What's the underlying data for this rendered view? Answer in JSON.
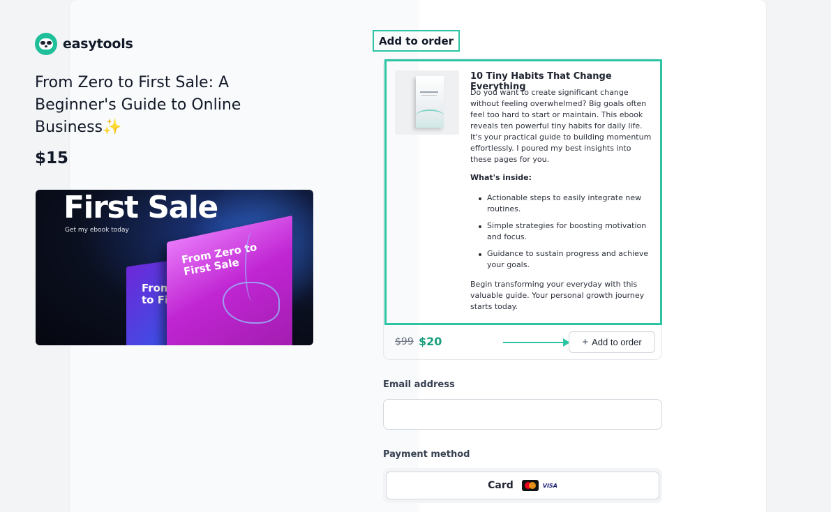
{
  "brand": {
    "name": "easytools"
  },
  "product": {
    "title": "From Zero to First Sale: A Beginner's Guide to Online Business",
    "emoji": "✨",
    "price": "$15",
    "cover": {
      "headline": "First Sale",
      "subline": "Get my ebook today",
      "book_front": "From Zero to First Sale",
      "book_back": "From Zero to First"
    }
  },
  "order_bump": {
    "label": "Add to order",
    "title": "10 Tiny Habits That Change Everything",
    "description": "Do you want to create significant change without feeling overwhelmed? Big goals often feel too hard to start or maintain. This ebook reveals ten powerful tiny habits for daily life. It's your practical guide to building momentum effortlessly. I poured my best insights into these pages for you.",
    "inside_heading": "What's inside:",
    "inside_items": [
      "Actionable steps to easily integrate new routines.",
      "Simple strategies for boosting motivation and focus.",
      "Guidance to sustain progress and achieve your goals."
    ],
    "closing": "Begin transforming your everyday with this valuable guide. Your personal growth journey starts today.",
    "old_price": "$99",
    "new_price": "$20",
    "button_label": "Add to order",
    "accent_color": "#2cc4a3"
  },
  "form": {
    "email_label": "Email address",
    "email_value": "",
    "email_placeholder": "",
    "payment_label": "Payment method",
    "payment_option": "Card",
    "visa_text": "VISA"
  },
  "icons": [
    "sloth-logo-icon",
    "plus-icon",
    "arrow-right-icon",
    "mastercard-icon",
    "visa-icon"
  ]
}
